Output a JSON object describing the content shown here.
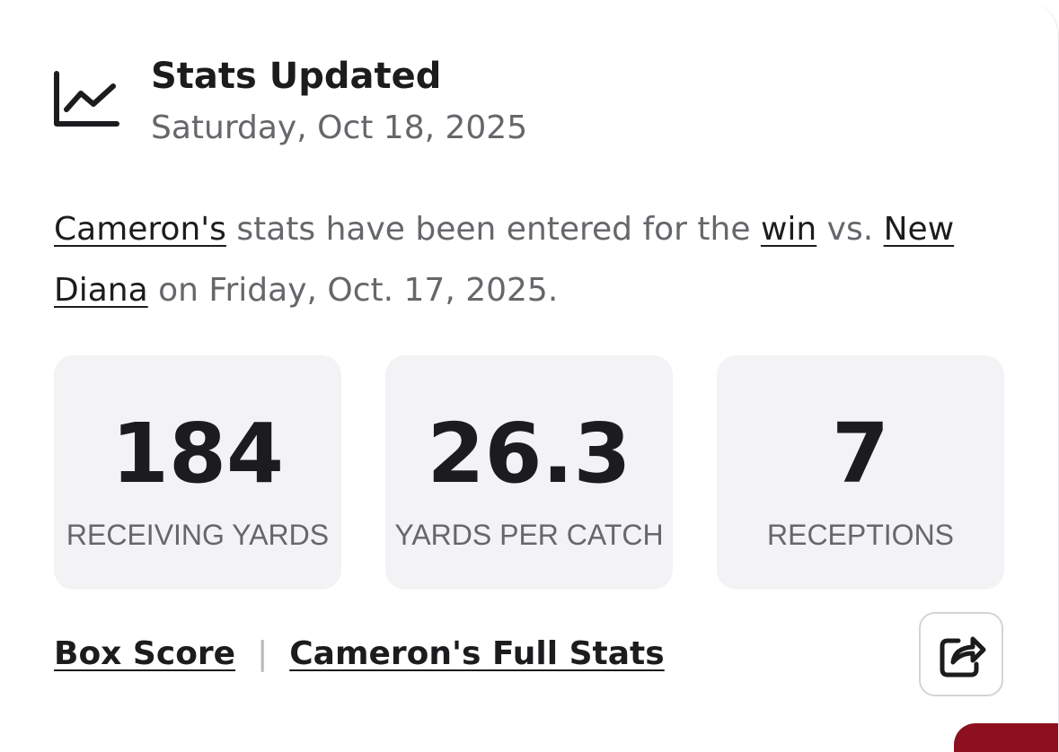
{
  "header": {
    "title": "Stats Updated",
    "date": "Saturday, Oct 18, 2025",
    "icon": "line-chart-icon"
  },
  "message": {
    "player_link": "Cameron's",
    "text_1": " stats have been entered for the ",
    "result_link": "win",
    "text_2": " vs. ",
    "opponent_link": "New Diana",
    "text_3": " on Friday, Oct. 17, 2025."
  },
  "stats": [
    {
      "value": "184",
      "label": "RECEIVING YARDS"
    },
    {
      "value": "26.3",
      "label": "YARDS PER CATCH"
    },
    {
      "value": "7",
      "label": "RECEPTIONS"
    }
  ],
  "links": {
    "box_score": "Box Score",
    "separator": "|",
    "full_stats": "Cameron's Full Stats"
  },
  "share": {
    "icon": "share-icon"
  },
  "colors": {
    "text_dark": "#1c1c1e",
    "text_muted": "#66666b",
    "stat_bg": "#f3f3f5",
    "accent_red": "#8e0f1d"
  }
}
